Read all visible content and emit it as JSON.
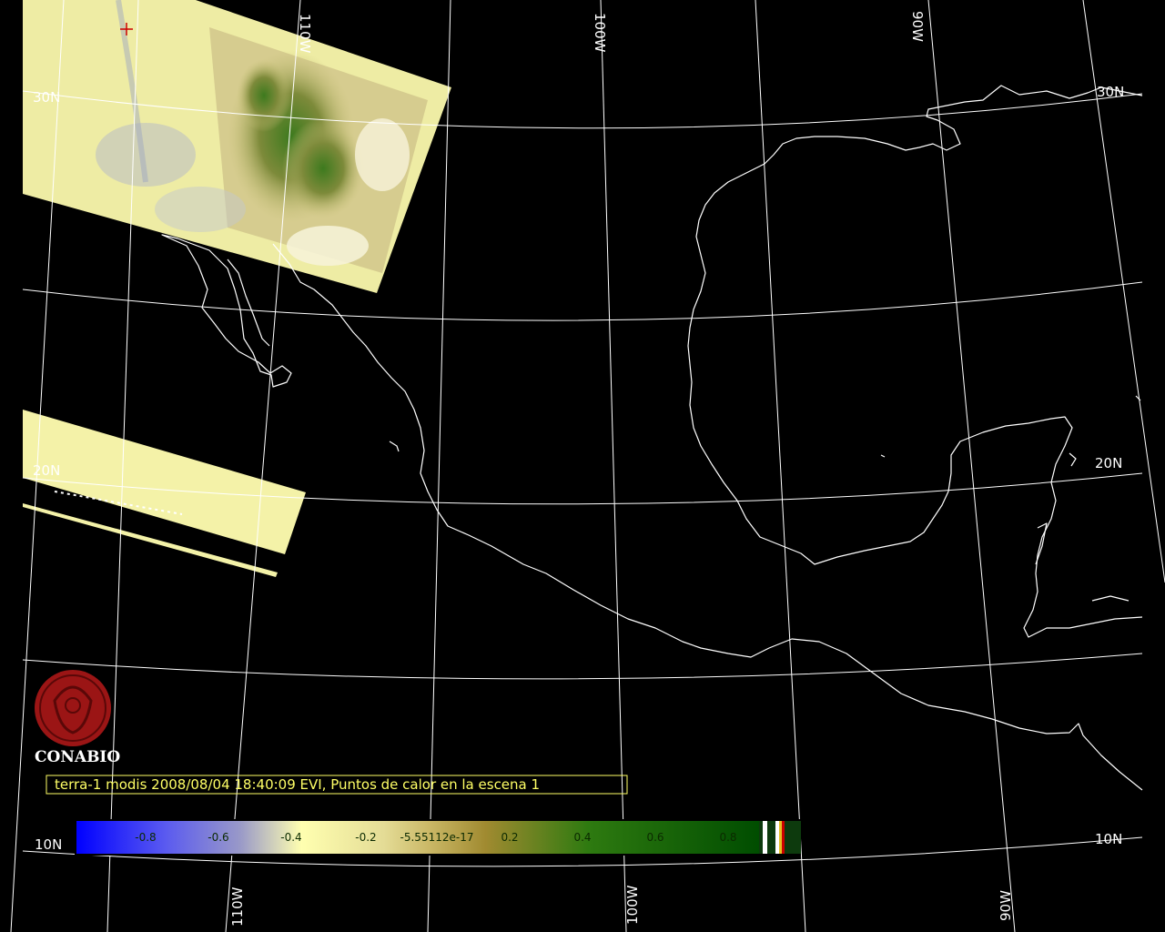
{
  "grid_labels": {
    "lat_30n_left": "30N",
    "lat_30n_right": "30N",
    "lat_20n_left": "20N",
    "lat_20n_right": "20N",
    "lat_10n_left": "10N",
    "lat_10n_right": "10N",
    "lon_110w_top": "110W",
    "lon_100w_top": "100W",
    "lon_90w_top": "90W",
    "lon_110w_bottom": "110W",
    "lon_100w_bottom": "100W",
    "lon_90w_bottom": "90W"
  },
  "logo": {
    "name": "CONABIO",
    "color": "#9b1515"
  },
  "caption": "terra-1 modis 2008/08/04 18:40:09 EVI, Puntos de calor en la escena 1",
  "legend": {
    "ticks": [
      "-0.8",
      "-0.6",
      "-0.4",
      "-0.2",
      "-5.55112e-17",
      "0.2",
      "0.4",
      "0.6",
      "0.8"
    ],
    "colors": {
      "low": "#0000ff",
      "mid_low": "#9999c8",
      "neutral": "#ffffb0",
      "mid": "#a08a30",
      "high": "#006600",
      "hotspot": "#cc0000"
    }
  },
  "marker": "hotspot-cross"
}
